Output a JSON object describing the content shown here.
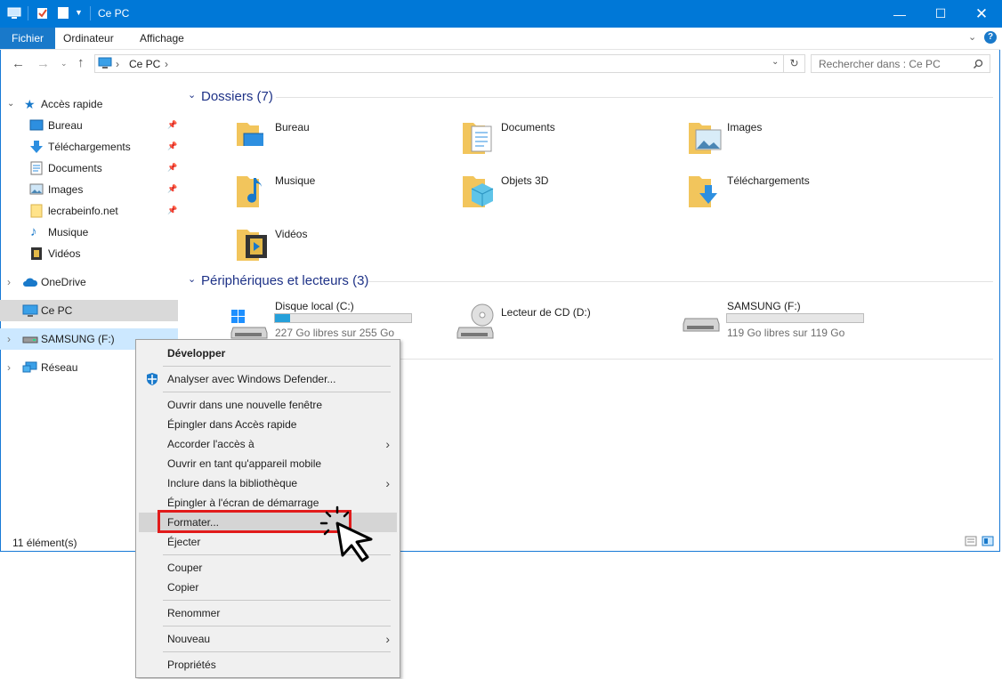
{
  "window": {
    "title": "Ce PC"
  },
  "ribbon": {
    "tabs": [
      "Fichier",
      "Ordinateur",
      "Affichage"
    ]
  },
  "address": {
    "path": "Ce PC",
    "search_placeholder": "Rechercher dans : Ce PC"
  },
  "nav": {
    "quick_access": "Accès rapide",
    "items": [
      {
        "label": "Bureau",
        "pinned": true
      },
      {
        "label": "Téléchargements",
        "pinned": true
      },
      {
        "label": "Documents",
        "pinned": true
      },
      {
        "label": "Images",
        "pinned": true
      },
      {
        "label": "lecrabeinfo.net",
        "pinned": true
      },
      {
        "label": "Musique",
        "pinned": false
      },
      {
        "label": "Vidéos",
        "pinned": false
      }
    ],
    "onedrive": "OneDrive",
    "thispc": "Ce PC",
    "samsung": "SAMSUNG (F:)",
    "network": "Réseau"
  },
  "folders_section": {
    "title": "Dossiers (7)"
  },
  "folders": [
    "Bureau",
    "Documents",
    "Images",
    "Musique",
    "Objets 3D",
    "Téléchargements",
    "Vidéos"
  ],
  "devices_section": {
    "title": "Périphériques et lecteurs (3)"
  },
  "drives": [
    {
      "name": "Disque local (C:)",
      "free": "227 Go libres sur 255 Go",
      "used_fraction": 0.11
    },
    {
      "name": "Lecteur de CD (D:)"
    },
    {
      "name": "SAMSUNG (F:)",
      "free": "119 Go libres sur 119 Go",
      "used_fraction": 0.0
    }
  ],
  "status": {
    "count": "11 élément(s)"
  },
  "context_menu": {
    "items": [
      {
        "label": "Développer",
        "bold": true
      },
      {
        "label": "Analyser avec Windows Defender..."
      },
      {
        "label": "Ouvrir dans une nouvelle fenêtre"
      },
      {
        "label": "Épingler dans Accès rapide"
      },
      {
        "label": "Accorder l'accès à",
        "submenu": true
      },
      {
        "label": "Ouvrir en tant qu'appareil mobile"
      },
      {
        "label": "Inclure dans la bibliothèque",
        "submenu": true
      },
      {
        "label": "Épingler à l'écran de démarrage"
      },
      {
        "label": "Formater..."
      },
      {
        "label": "Éjecter"
      },
      {
        "label": "Couper"
      },
      {
        "label": "Copier"
      },
      {
        "label": "Renommer"
      },
      {
        "label": "Nouveau",
        "submenu": true
      },
      {
        "label": "Propriétés"
      }
    ]
  },
  "colors": {
    "accent": "#0078d7",
    "highlight": "#e11b1b",
    "section": "#1e3287"
  }
}
